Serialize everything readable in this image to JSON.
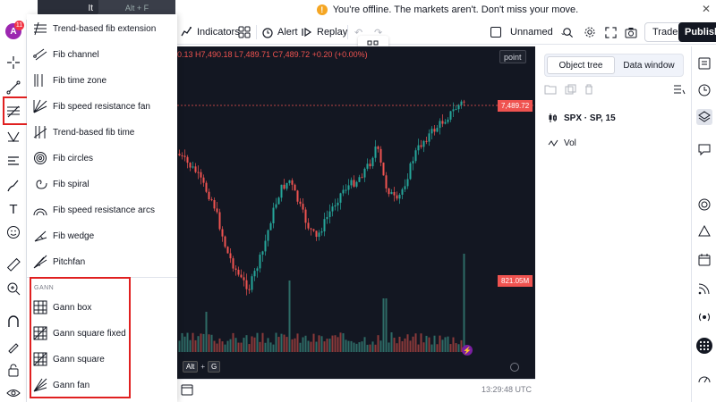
{
  "banner": {
    "text": "You're offline. The markets aren't. Don't miss your move.",
    "icon": "warning-icon"
  },
  "tooltip": {
    "left": "It",
    "right": "Alt + F"
  },
  "toolbar": {
    "indicators": "Indicators",
    "alert": "Alert",
    "replay": "Replay",
    "layout_name": "Unnamed",
    "trade": "Trade",
    "publish": "Publish"
  },
  "avatar": {
    "letter": "A",
    "badge": "11"
  },
  "menu": {
    "fib_items": [
      {
        "label": "Trend-based fib extension",
        "icon": "fib-extension-icon"
      },
      {
        "label": "Fib channel",
        "icon": "fib-channel-icon"
      },
      {
        "label": "Fib time zone",
        "icon": "fib-time-zone-icon"
      },
      {
        "label": "Fib speed resistance fan",
        "icon": "fib-fan-icon"
      },
      {
        "label": "Trend-based fib time",
        "icon": "fib-time-icon"
      },
      {
        "label": "Fib circles",
        "icon": "fib-circles-icon"
      },
      {
        "label": "Fib spiral",
        "icon": "fib-spiral-icon"
      },
      {
        "label": "Fib speed resistance arcs",
        "icon": "fib-arcs-icon"
      },
      {
        "label": "Fib wedge",
        "icon": "fib-wedge-icon"
      },
      {
        "label": "Pitchfan",
        "icon": "pitchfan-icon"
      }
    ],
    "gann_label": "GANN",
    "gann_items": [
      {
        "label": "Gann box",
        "icon": "gann-box-icon"
      },
      {
        "label": "Gann square fixed",
        "icon": "gann-square-fixed-icon"
      },
      {
        "label": "Gann square",
        "icon": "gann-square-icon"
      },
      {
        "label": "Gann fan",
        "icon": "gann-fan-icon"
      }
    ]
  },
  "chart": {
    "ohlc_text": "0.13 H7,490.18 L7,489.71 C7,489.72 +0.20 (+0.00%)",
    "point_label": "point",
    "last_price": "7,489.72",
    "volume_label": "821.05M",
    "alt_key": "Alt",
    "plus": "+",
    "g_key": "G",
    "time_text": "13:29:48 UTC"
  },
  "right_panel": {
    "tabs": [
      "Object tree",
      "Data window"
    ],
    "active_tab": 0,
    "symbol": "SPX · SP, 15",
    "vol": "Vol"
  },
  "colors": {
    "up": "#26a69a",
    "down": "#ef5350",
    "chart_bg": "#131722",
    "highlight_box": "#e02020"
  }
}
